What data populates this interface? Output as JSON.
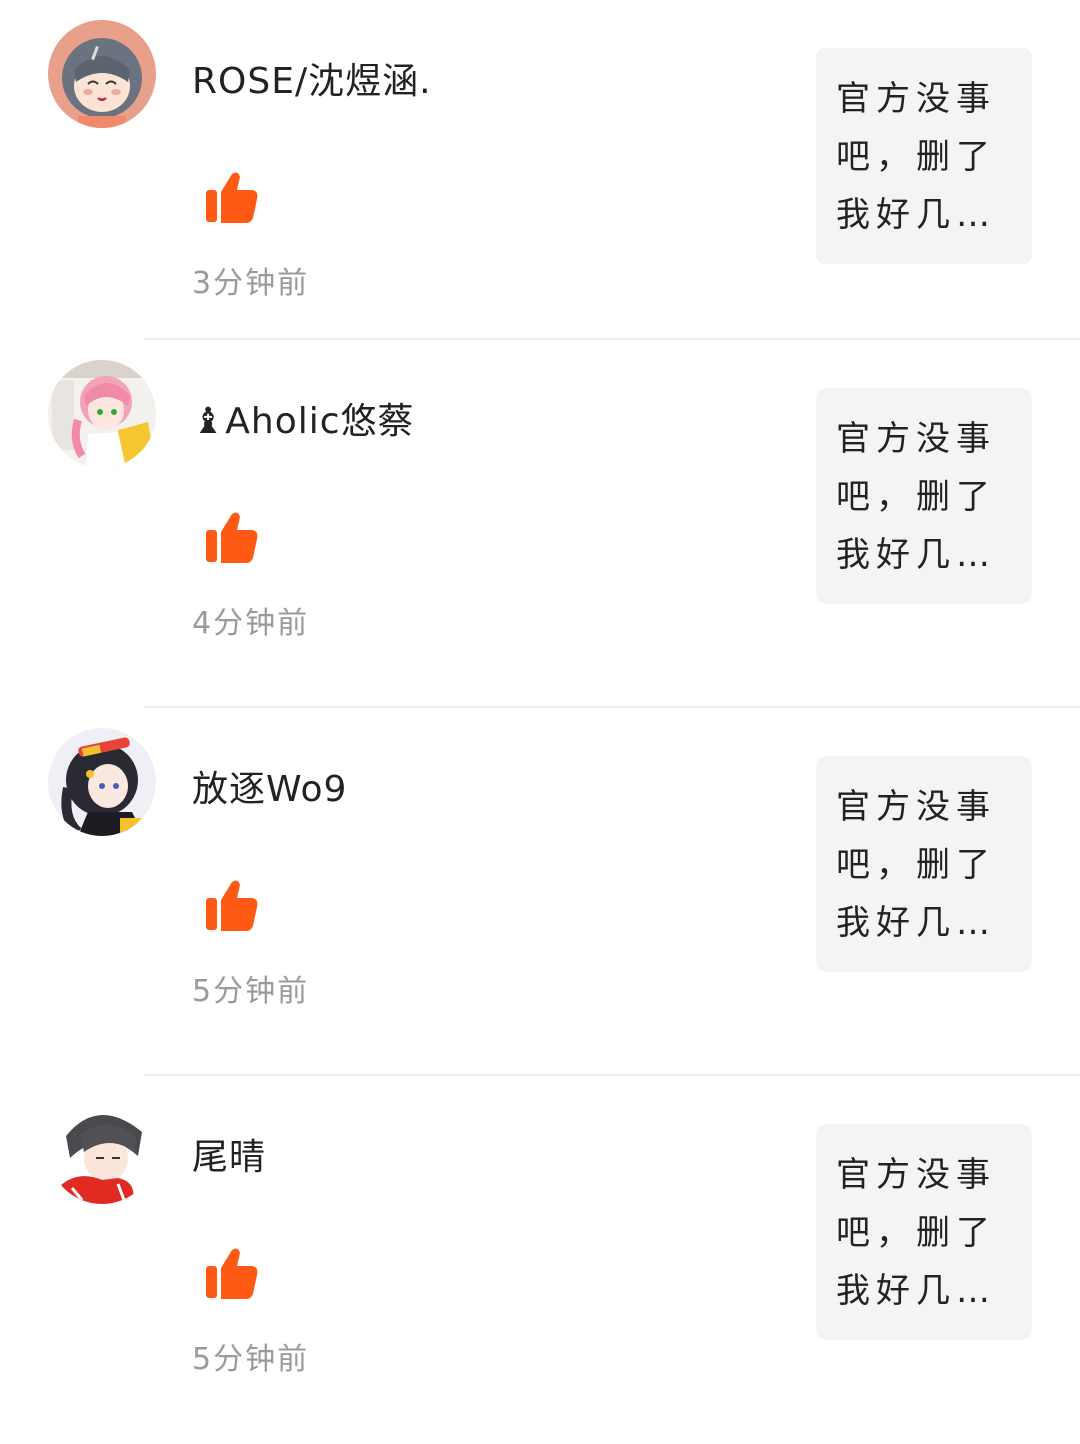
{
  "colors": {
    "like_accent": "#ff5a14",
    "preview_bg": "#f4f4f4",
    "time_text": "#9a9a9a",
    "divider": "#ececec"
  },
  "comments": [
    {
      "username": "ROSE/沈煜涵.",
      "time": "3分钟前",
      "preview": "官方没事吧，删了我好几…",
      "like_icon": "thumbs-up-icon"
    },
    {
      "username": "♝Aholic悠蔡",
      "time": "4分钟前",
      "preview": "官方没事吧，删了我好几…",
      "like_icon": "thumbs-up-icon"
    },
    {
      "username": "放逐Wo9",
      "time": "5分钟前",
      "preview": "官方没事吧，删了我好几…",
      "like_icon": "thumbs-up-icon"
    },
    {
      "username": "尾晴",
      "time": "5分钟前",
      "preview": "官方没事吧，删了我好几…",
      "like_icon": "thumbs-up-icon"
    }
  ]
}
